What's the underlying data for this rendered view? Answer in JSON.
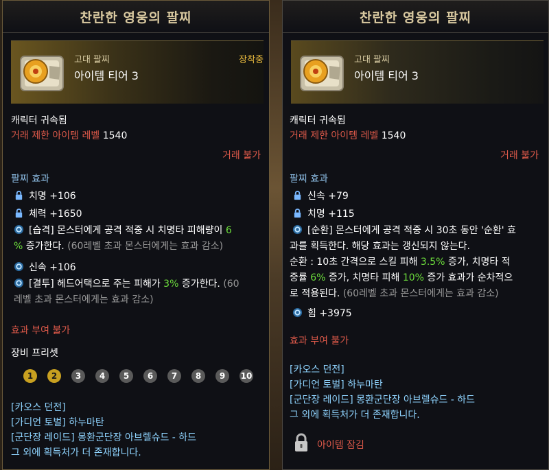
{
  "left": {
    "title": "찬란한 영웅의 팔찌",
    "grade": "고대 팔찌",
    "tier": "아이템 티어 3",
    "equipped": "장착중",
    "bound": "캐릭터 귀속됨",
    "trade_level_label": "거래 제한 아이템 레벨",
    "trade_level_value": "1540",
    "trade_status": "거래 불가",
    "effect_header": "팔찌 효과",
    "stat1": "치명 +106",
    "stat2": "체력 +1650",
    "effect1_name": "[습격]",
    "effect1_text_a": " 몬스터에게 공격 적중 시 치명타 피해량이 ",
    "effect1_val": "6",
    "effect1_val2": "%",
    "effect1_text_b": " 증가한다. ",
    "effect1_note": "(60레벨 초과 몬스터에게는 효과 감소)",
    "stat3": "신속 +106",
    "effect2_name": "[결투]",
    "effect2_text_a": " 헤드어택으로 주는 피해가 ",
    "effect2_val": "3%",
    "effect2_text_b": " 증가한다. ",
    "effect2_note_a": "(60",
    "effect2_note_b": "레벨 초과 몬스터에게는 효과 감소)",
    "no_effect": "효과 부여 불가",
    "preset_header": "장비 프리셋",
    "presets": [
      "1",
      "2",
      "3",
      "4",
      "5",
      "6",
      "7",
      "8",
      "9",
      "10"
    ],
    "sources": [
      "[카오스 던전]",
      "[가디언 토벌] 하누마탄",
      "[군단장 레이드] 몽환군단장 아브렐슈드 - 하드",
      "그 외에 획득처가 더 존재합니다."
    ]
  },
  "right": {
    "title": "찬란한 영웅의 팔찌",
    "grade": "고대 팔찌",
    "tier": "아이템 티어 3",
    "bound": "캐릭터 귀속됨",
    "trade_level_label": "거래 제한 아이템 레벨",
    "trade_level_value": "1540",
    "trade_status": "거래 불가",
    "effect_header": "팔찌 효과",
    "stat1": "신속 +79",
    "stat2": "치명 +115",
    "effect_name": "[순환]",
    "effect_text1": " 몬스터에게 공격 적중 시 30초 동안 '순환' 효",
    "effect_text2": "과를 획득한다. 해당 효과는 갱신되지 않는다.",
    "effect_text3a": "순환 : 10초 간격으로 스킬 피해 ",
    "effect_v1": "3.5%",
    "effect_text3b": " 증가, 치명타 적",
    "effect_text4a": "중률 ",
    "effect_v2": "6%",
    "effect_text4b": " 증가, 치명타 피해 ",
    "effect_v3": "10%",
    "effect_text4c": " 증가 효과가 순차적으",
    "effect_text5a": "로 적용된다. ",
    "effect_note": "(60레벨 초과 몬스터에게는 효과 감소)",
    "stat3": "힘 +3975",
    "no_effect": "효과 부여 불가",
    "sources": [
      "[카오스 던전]",
      "[가디언 토벌] 하누마탄",
      "[군단장 레이드] 몽환군단장 아브렐슈드 - 하드",
      "그 외에 획득처가 더 존재합니다."
    ],
    "locked": "아이템 잠김"
  },
  "colors": {
    "gold": "#f0c040",
    "red": "#e05a4a",
    "green": "#6cdc3c",
    "blue": "#8fc0e8"
  }
}
